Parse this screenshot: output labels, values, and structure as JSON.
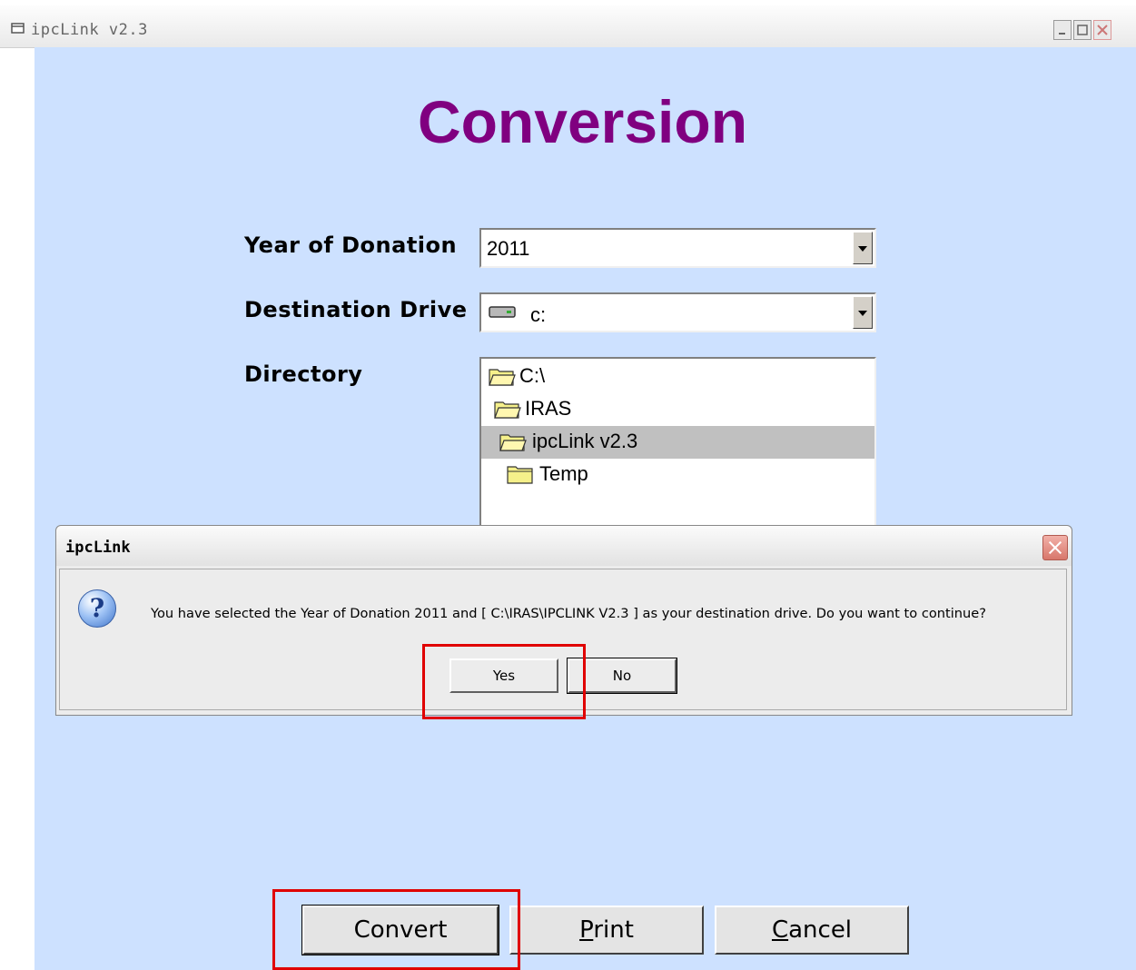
{
  "window": {
    "title": "ipcLink v2.3"
  },
  "page": {
    "heading": "Conversion"
  },
  "form": {
    "year_label": "Year of Donation",
    "year_value": "2011",
    "drive_label": "Destination Drive",
    "drive_value": "c:",
    "directory_label": "Directory",
    "directories": [
      {
        "label": "C:\\",
        "selected": false
      },
      {
        "label": "IRAS",
        "selected": false
      },
      {
        "label": "ipcLink v2.3",
        "selected": true
      },
      {
        "label": "Temp",
        "selected": false
      }
    ]
  },
  "buttons": {
    "convert_pre": "Convert",
    "print_ul": "P",
    "print_rest": "rint",
    "cancel_ul": "C",
    "cancel_rest": "ancel"
  },
  "dialog": {
    "title": "ipcLink",
    "message": "You have selected the Year of Donation 2011 and [ C:\\IRAS\\IPCLINK V2.3 ]  as your destination drive. Do you want to continue?",
    "yes_label": "Yes",
    "no_label": "No"
  },
  "colors": {
    "client_background": "#cde1ff",
    "heading": "#800080",
    "highlight": "#e00000",
    "selected_row": "#c0c0c0"
  }
}
